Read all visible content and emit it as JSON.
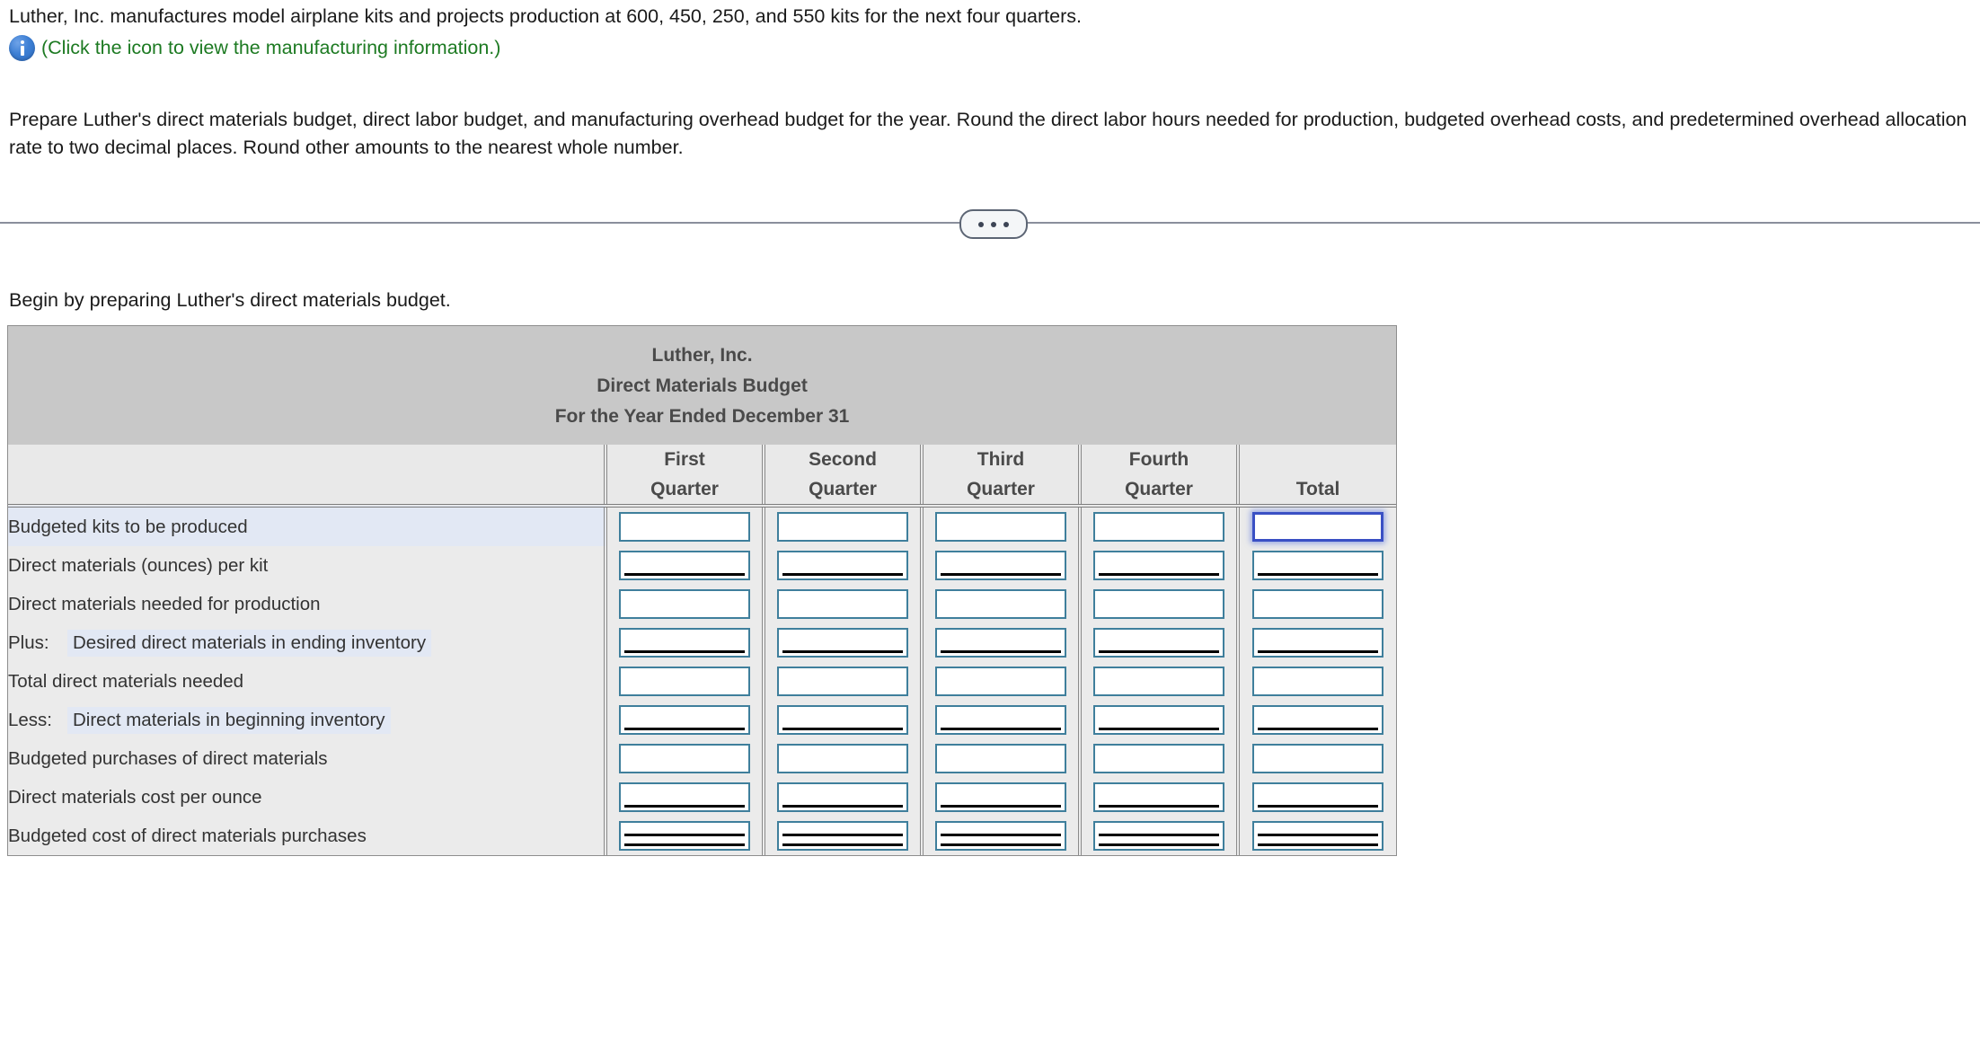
{
  "problem": {
    "statement": "Luther, Inc. manufactures model airplane kits and projects production at 600, 450, 250, and 550 kits for the next four quarters.",
    "icon_link": "(Click the icon to view the manufacturing information.)",
    "icon_name": "info-icon",
    "instructions": "Prepare Luther's direct materials budget, direct labor budget, and manufacturing overhead budget for the year. Round the direct labor hours needed for production, budgeted overhead costs, and predetermined overhead allocation rate to two decimal places. Round other amounts to the nearest whole number."
  },
  "divider": {
    "more_label": "•••"
  },
  "begin_text": "Begin by preparing Luther's direct materials budget.",
  "worksheet": {
    "title_lines": [
      "Luther, Inc.",
      "Direct Materials Budget",
      "For the Year Ended December 31"
    ],
    "column_headers": [
      {
        "line1": "",
        "line2": ""
      },
      {
        "line1": "First",
        "line2": "Quarter"
      },
      {
        "line1": "Second",
        "line2": "Quarter"
      },
      {
        "line1": "Third",
        "line2": "Quarter"
      },
      {
        "line1": "Fourth",
        "line2": "Quarter"
      },
      {
        "line1": "",
        "line2": "Total"
      }
    ],
    "rows": [
      {
        "prefix": "",
        "label": "Budgeted kits to be produced",
        "values": [
          "",
          "",
          "",
          "",
          ""
        ]
      },
      {
        "prefix": "",
        "label": "Direct materials (ounces) per kit",
        "values": [
          "",
          "",
          "",
          "",
          ""
        ]
      },
      {
        "prefix": "",
        "label": "Direct materials needed for production",
        "values": [
          "",
          "",
          "",
          "",
          ""
        ]
      },
      {
        "prefix": "Plus:",
        "label": "Desired direct materials in ending inventory",
        "values": [
          "",
          "",
          "",
          "",
          ""
        ]
      },
      {
        "prefix": "",
        "label": "Total direct materials needed",
        "values": [
          "",
          "",
          "",
          "",
          ""
        ]
      },
      {
        "prefix": "Less:",
        "label": "Direct materials in beginning inventory",
        "values": [
          "",
          "",
          "",
          "",
          ""
        ]
      },
      {
        "prefix": "",
        "label": "Budgeted purchases of direct materials",
        "values": [
          "",
          "",
          "",
          "",
          ""
        ]
      },
      {
        "prefix": "",
        "label": "Direct materials cost per ounce",
        "values": [
          "",
          "",
          "",
          "",
          ""
        ]
      },
      {
        "prefix": "",
        "label": "Budgeted cost of direct materials purchases",
        "values": [
          "",
          "",
          "",
          "",
          ""
        ]
      }
    ]
  },
  "colors": {
    "title_band": "#c8c8c8",
    "header_band": "#e9e9e9",
    "row_band": "#ebebeb",
    "row_highlight": "#e2e8f4",
    "input_border": "#3f7f9c",
    "selected_border": "#3a50c4",
    "link_green": "#1d7a22",
    "icon_blue": "#3d7fd4"
  }
}
